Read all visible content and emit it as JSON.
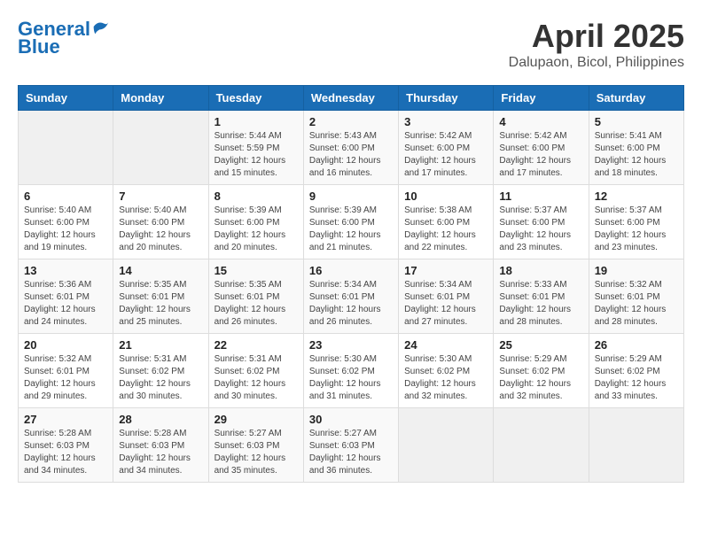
{
  "logo": {
    "line1": "General",
    "line2": "Blue"
  },
  "title": "April 2025",
  "subtitle": "Dalupaon, Bicol, Philippines",
  "weekdays": [
    "Sunday",
    "Monday",
    "Tuesday",
    "Wednesday",
    "Thursday",
    "Friday",
    "Saturday"
  ],
  "weeks": [
    [
      {
        "day": "",
        "info": ""
      },
      {
        "day": "",
        "info": ""
      },
      {
        "day": "1",
        "info": "Sunrise: 5:44 AM\nSunset: 5:59 PM\nDaylight: 12 hours and 15 minutes."
      },
      {
        "day": "2",
        "info": "Sunrise: 5:43 AM\nSunset: 6:00 PM\nDaylight: 12 hours and 16 minutes."
      },
      {
        "day": "3",
        "info": "Sunrise: 5:42 AM\nSunset: 6:00 PM\nDaylight: 12 hours and 17 minutes."
      },
      {
        "day": "4",
        "info": "Sunrise: 5:42 AM\nSunset: 6:00 PM\nDaylight: 12 hours and 17 minutes."
      },
      {
        "day": "5",
        "info": "Sunrise: 5:41 AM\nSunset: 6:00 PM\nDaylight: 12 hours and 18 minutes."
      }
    ],
    [
      {
        "day": "6",
        "info": "Sunrise: 5:40 AM\nSunset: 6:00 PM\nDaylight: 12 hours and 19 minutes."
      },
      {
        "day": "7",
        "info": "Sunrise: 5:40 AM\nSunset: 6:00 PM\nDaylight: 12 hours and 20 minutes."
      },
      {
        "day": "8",
        "info": "Sunrise: 5:39 AM\nSunset: 6:00 PM\nDaylight: 12 hours and 20 minutes."
      },
      {
        "day": "9",
        "info": "Sunrise: 5:39 AM\nSunset: 6:00 PM\nDaylight: 12 hours and 21 minutes."
      },
      {
        "day": "10",
        "info": "Sunrise: 5:38 AM\nSunset: 6:00 PM\nDaylight: 12 hours and 22 minutes."
      },
      {
        "day": "11",
        "info": "Sunrise: 5:37 AM\nSunset: 6:00 PM\nDaylight: 12 hours and 23 minutes."
      },
      {
        "day": "12",
        "info": "Sunrise: 5:37 AM\nSunset: 6:00 PM\nDaylight: 12 hours and 23 minutes."
      }
    ],
    [
      {
        "day": "13",
        "info": "Sunrise: 5:36 AM\nSunset: 6:01 PM\nDaylight: 12 hours and 24 minutes."
      },
      {
        "day": "14",
        "info": "Sunrise: 5:35 AM\nSunset: 6:01 PM\nDaylight: 12 hours and 25 minutes."
      },
      {
        "day": "15",
        "info": "Sunrise: 5:35 AM\nSunset: 6:01 PM\nDaylight: 12 hours and 26 minutes."
      },
      {
        "day": "16",
        "info": "Sunrise: 5:34 AM\nSunset: 6:01 PM\nDaylight: 12 hours and 26 minutes."
      },
      {
        "day": "17",
        "info": "Sunrise: 5:34 AM\nSunset: 6:01 PM\nDaylight: 12 hours and 27 minutes."
      },
      {
        "day": "18",
        "info": "Sunrise: 5:33 AM\nSunset: 6:01 PM\nDaylight: 12 hours and 28 minutes."
      },
      {
        "day": "19",
        "info": "Sunrise: 5:32 AM\nSunset: 6:01 PM\nDaylight: 12 hours and 28 minutes."
      }
    ],
    [
      {
        "day": "20",
        "info": "Sunrise: 5:32 AM\nSunset: 6:01 PM\nDaylight: 12 hours and 29 minutes."
      },
      {
        "day": "21",
        "info": "Sunrise: 5:31 AM\nSunset: 6:02 PM\nDaylight: 12 hours and 30 minutes."
      },
      {
        "day": "22",
        "info": "Sunrise: 5:31 AM\nSunset: 6:02 PM\nDaylight: 12 hours and 30 minutes."
      },
      {
        "day": "23",
        "info": "Sunrise: 5:30 AM\nSunset: 6:02 PM\nDaylight: 12 hours and 31 minutes."
      },
      {
        "day": "24",
        "info": "Sunrise: 5:30 AM\nSunset: 6:02 PM\nDaylight: 12 hours and 32 minutes."
      },
      {
        "day": "25",
        "info": "Sunrise: 5:29 AM\nSunset: 6:02 PM\nDaylight: 12 hours and 32 minutes."
      },
      {
        "day": "26",
        "info": "Sunrise: 5:29 AM\nSunset: 6:02 PM\nDaylight: 12 hours and 33 minutes."
      }
    ],
    [
      {
        "day": "27",
        "info": "Sunrise: 5:28 AM\nSunset: 6:03 PM\nDaylight: 12 hours and 34 minutes."
      },
      {
        "day": "28",
        "info": "Sunrise: 5:28 AM\nSunset: 6:03 PM\nDaylight: 12 hours and 34 minutes."
      },
      {
        "day": "29",
        "info": "Sunrise: 5:27 AM\nSunset: 6:03 PM\nDaylight: 12 hours and 35 minutes."
      },
      {
        "day": "30",
        "info": "Sunrise: 5:27 AM\nSunset: 6:03 PM\nDaylight: 12 hours and 36 minutes."
      },
      {
        "day": "",
        "info": ""
      },
      {
        "day": "",
        "info": ""
      },
      {
        "day": "",
        "info": ""
      }
    ]
  ]
}
